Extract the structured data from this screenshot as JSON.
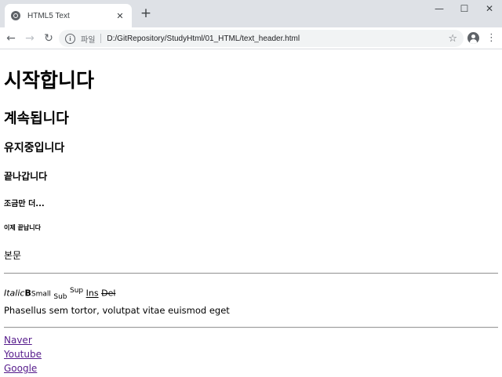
{
  "browser": {
    "tab_title": "HTML5 Text",
    "tab_close": "✕",
    "new_tab": "+",
    "window_controls": {
      "minimize": "—",
      "maximize": "☐",
      "close": "✕"
    },
    "nav": {
      "back": "←",
      "forward": "→",
      "reload": "↻"
    },
    "omnibox": {
      "info": "i",
      "label": "파일",
      "url": "D:/GitRepository/StudyHtml/01_HTML/text_header.html"
    },
    "star": "☆",
    "menu": "⋮"
  },
  "page": {
    "h1": "시작합니다",
    "h2": "계속됩니다",
    "h3": "유지중입니다",
    "h4": "끝나갑니다",
    "h5": "조금만 더...",
    "h6": "이제 끝납니다",
    "body_text": "본문",
    "inline": {
      "italic": "Italic",
      "bold": "B",
      "small": "Small",
      "sub": "Sub",
      "sup": "Sup",
      "ins": "Ins",
      "del": "Del"
    },
    "paragraph": "Phasellus sem tortor, volutpat vitae euismod eget",
    "links": [
      "Naver",
      "Youtube",
      "Google"
    ]
  }
}
